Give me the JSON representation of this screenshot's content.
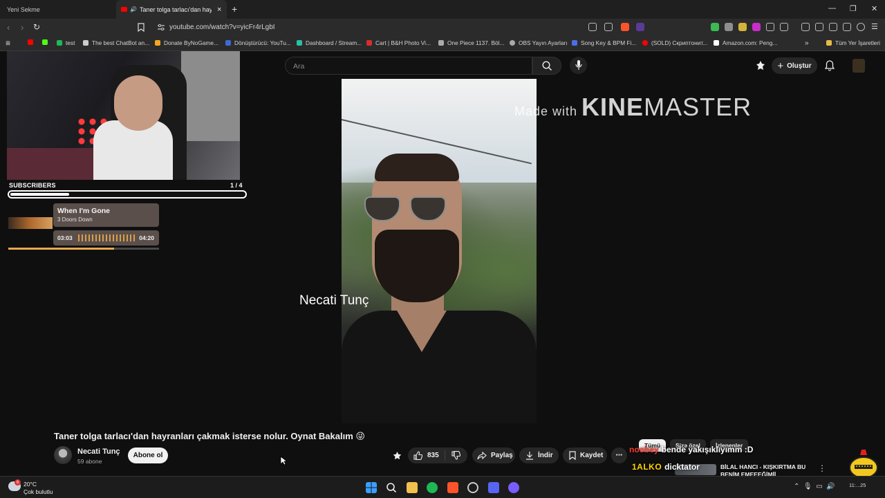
{
  "browser": {
    "tabs": [
      {
        "label": "Yeni Sekme"
      },
      {
        "label": "Taner tolga tarlacı'dan hayranl..."
      }
    ],
    "url": "youtube.com/watch?v=yicFr4rLgbI",
    "bookmarks": [
      {
        "label": "test",
        "color": "#1db954"
      },
      {
        "label": "The best ChatBot an...",
        "color": "#cccccc"
      },
      {
        "label": "Donate ByNoGame...",
        "color": "#f5a623"
      },
      {
        "label": "Dönüştürücü: YouTu...",
        "color": "#3b6bd6"
      },
      {
        "label": "Dashboard / Stream...",
        "color": "#2bc0a3"
      },
      {
        "label": "Cart | B&H Photo Vi...",
        "color": "#d62d2d"
      },
      {
        "label": "One Piece 1137. Böl...",
        "color": "#aaaaaa"
      },
      {
        "label": "OBS Yayın Ayarları",
        "color": "#aaaaaa"
      },
      {
        "label": "Song Key & BPM Fi...",
        "color": "#4a6fe3"
      },
      {
        "label": "(SOLD) Скриптонит...",
        "color": "#ff0000"
      },
      {
        "label": "Amazon.com: Peng...",
        "color": "#ffffff"
      }
    ],
    "all_bookmarks": "Tüm Yer İşaretleri"
  },
  "youtube": {
    "search_placeholder": "Ara",
    "create_label": "Oluştur"
  },
  "overlay": {
    "watermark_prefix": "Made with",
    "watermark_bold": "KINE",
    "watermark_thin": "MASTER",
    "name_text": "Necati Tunç",
    "subscribers_label": "SUBSCRIBERS",
    "subscribers_count": "1 / 4",
    "subscribers_progress": 0.25,
    "song_title": "When I'm Gone",
    "song_artist": "3 Doors Down",
    "song_current": "03:03",
    "song_total": "04:20",
    "song_progress": 0.7
  },
  "video": {
    "title": "Taner tolga tarlacı'dan hayranları çakmak isterse nolur. Oynat Bakalım 😜",
    "channel": "Necati Tunç",
    "subscribers": "59 abone",
    "subscribe_label": "Abone ol",
    "likes": "835",
    "share_label": "Paylaş",
    "download_label": "İndir",
    "save_label": "Kaydet"
  },
  "sidebar": {
    "chips": [
      "Tümü",
      "Sizə özel",
      "İzlenenler"
    ],
    "rec_title": "BİLAL HANCI - KIŞKIRTMA BU BENİM EMEEEĞİMİİ"
  },
  "chat": [
    {
      "user": "noobey",
      "message": "bende yakışıklıyımm :D"
    },
    {
      "user": "1ALKO",
      "message": "dicktator"
    }
  ],
  "taskbar": {
    "temperature": "20°C",
    "weather": "Çok bulutlu",
    "weather_badge": "6",
    "clock": "11:...25"
  }
}
